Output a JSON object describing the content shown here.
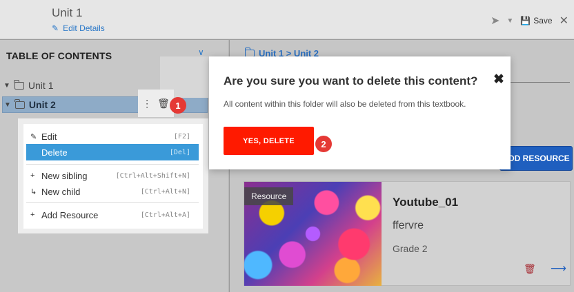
{
  "header": {
    "title": "Unit 1",
    "edit_details": "Edit Details",
    "save_label": "Save"
  },
  "toc": {
    "title": "TABLE OF CONTENTS",
    "items": [
      {
        "label": "Unit 1"
      },
      {
        "label": "Unit 2"
      }
    ]
  },
  "context_menu": {
    "items": [
      {
        "label": "Edit",
        "shortcut": "[F2]"
      },
      {
        "label": "Delete",
        "shortcut": "[Del]"
      },
      {
        "label": "New sibling",
        "shortcut": "[Ctrl+Alt+Shift+N]"
      },
      {
        "label": "New child",
        "shortcut": "[Ctrl+Alt+N]"
      },
      {
        "label": "Add Resource",
        "shortcut": "[Ctrl+Alt+A]"
      }
    ]
  },
  "breadcrumb": {
    "text": "Unit 1 > Unit 2"
  },
  "add_resource_label": "ADD RESOURCE",
  "resource_card": {
    "tag": "Resource",
    "title": "Youtube_01",
    "description": "ffervre",
    "grade": "Grade 2"
  },
  "modal": {
    "title": "Are you sure you want to delete this content?",
    "body": "All content within this folder will also be deleted from this textbook.",
    "confirm_label": "YES, DELETE"
  },
  "badges": {
    "first": "1",
    "second": "2"
  },
  "colors": {
    "accent_red": "#ff1a00",
    "primary_blue": "#1f5fbf",
    "menu_highlight": "#3a9ad9"
  }
}
